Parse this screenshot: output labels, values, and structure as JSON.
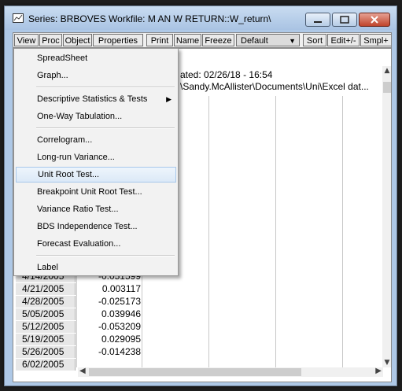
{
  "window": {
    "title": "Series: BRBOVES   Workfile: M AN W RETURN::W_return\\",
    "icon": "series-window-icon",
    "buttons": {
      "minimize": "minimize-icon",
      "maximize": "maximize-icon",
      "close": "close-icon"
    }
  },
  "toolbar": {
    "view": "View",
    "proc": "Proc",
    "object": "Object",
    "properties": "Properties",
    "print": "Print",
    "name": "Name",
    "freeze": "Freeze",
    "display_select": "Default",
    "sort": "Sort",
    "edit": "Edit+/-",
    "smpl": "Smpl+"
  },
  "info": {
    "modified": "ated: 02/26/18 - 16:54",
    "path": "\\Sandy.McAllister\\Documents\\Uni\\Excel dat..."
  },
  "rows": [
    {
      "date": "4/14/2005",
      "value": "-0.051599"
    },
    {
      "date": "4/21/2005",
      "value": "0.003117"
    },
    {
      "date": "4/28/2005",
      "value": "-0.025173"
    },
    {
      "date": "5/05/2005",
      "value": "0.039946"
    },
    {
      "date": "5/12/2005",
      "value": "-0.053209"
    },
    {
      "date": "5/19/2005",
      "value": "0.029095"
    },
    {
      "date": "5/26/2005",
      "value": "-0.014238"
    },
    {
      "date": "6/02/2005",
      "value": ""
    }
  ],
  "menu": {
    "items": [
      {
        "label": "SpreadSheet"
      },
      {
        "label": "Graph..."
      },
      {
        "label": "Descriptive Statistics & Tests"
      },
      {
        "label": "One-Way Tabulation..."
      },
      {
        "label": "Correlogram..."
      },
      {
        "label": "Long-run Variance..."
      },
      {
        "label": "Unit Root Test..."
      },
      {
        "label": "Breakpoint Unit Root Test..."
      },
      {
        "label": "Variance Ratio Test..."
      },
      {
        "label": "BDS Independence Test..."
      },
      {
        "label": "Forecast Evaluation..."
      },
      {
        "label": "Label"
      }
    ],
    "highlighted": "Unit Root Test..."
  },
  "colors": {
    "title_bar": "#aec8e6",
    "close_button": "#c0442c",
    "menu_highlight": "#dce9f7"
  }
}
